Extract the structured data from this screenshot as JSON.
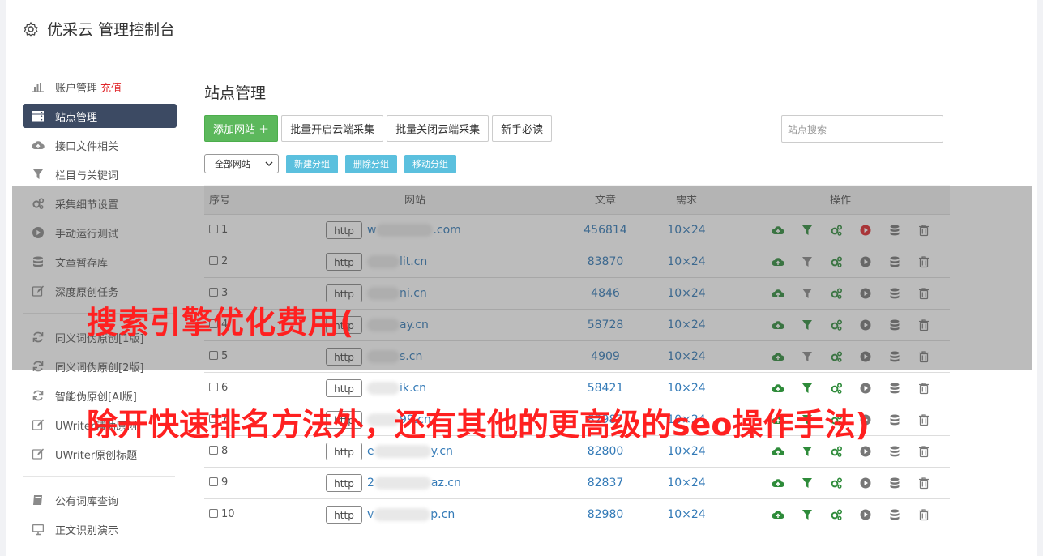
{
  "header": {
    "title": "优采云 管理控制台"
  },
  "sidebar": {
    "items": [
      {
        "label": "账户管理",
        "extra": "充值",
        "icon": "bar-chart-icon"
      },
      {
        "label": "站点管理",
        "icon": "server-icon",
        "active": true
      },
      {
        "label": "接口文件相关",
        "icon": "cloud-upload-icon"
      },
      {
        "label": "栏目与关键词",
        "icon": "filter-icon"
      },
      {
        "label": "采集细节设置",
        "icon": "gears-icon"
      },
      {
        "label": "手动运行测试",
        "icon": "play-circle-icon"
      },
      {
        "label": "文章暂存库",
        "icon": "database-icon"
      },
      {
        "label": "深度原创任务",
        "icon": "edit-icon"
      }
    ],
    "items2": [
      {
        "label": "同义词伪原创[1版]",
        "icon": "refresh-icon"
      },
      {
        "label": "同义词伪原创[2版]",
        "icon": "refresh-icon"
      },
      {
        "label": "智能伪原创[AI版]",
        "icon": "refresh-icon"
      },
      {
        "label": "UWriter辅助原创",
        "icon": "edit-icon"
      },
      {
        "label": "UWriter原创标题",
        "icon": "edit-icon"
      }
    ],
    "items3": [
      {
        "label": "公有词库查询",
        "icon": "book-icon"
      },
      {
        "label": "正文识别演示",
        "icon": "monitor-icon"
      }
    ]
  },
  "main": {
    "title": "站点管理",
    "buttons": {
      "add": "添加网站 ＋",
      "enable": "批量开启云端采集",
      "disable": "批量关闭云端采集",
      "guide": "新手必读"
    },
    "search_placeholder": "站点搜索",
    "group_select": "全部网站",
    "group_buttons": {
      "new": "新建分组",
      "delete": "删除分组",
      "move": "移动分组"
    },
    "columns": {
      "num": "序号",
      "site": "网站",
      "articles": "文章",
      "demand": "需求",
      "ops": "操作"
    },
    "rows": [
      {
        "num": "1",
        "prefix": "w",
        "suffix": ".com",
        "articles": "456814",
        "demand": "10×24",
        "play_active": true,
        "filter_active": true
      },
      {
        "num": "2",
        "prefix": "",
        "suffix": "lit.cn",
        "articles": "83870",
        "demand": "10×24",
        "play_active": false,
        "filter_active": false
      },
      {
        "num": "3",
        "prefix": "",
        "suffix": "ni.cn",
        "articles": "4846",
        "demand": "10×24",
        "play_active": false,
        "filter_active": false
      },
      {
        "num": "4",
        "prefix": "",
        "suffix": "ay.cn",
        "articles": "58728",
        "demand": "10×24",
        "play_active": false,
        "filter_active": true
      },
      {
        "num": "5",
        "prefix": "",
        "suffix": "s.cn",
        "articles": "4909",
        "demand": "10×24",
        "play_active": false,
        "filter_active": false
      },
      {
        "num": "6",
        "prefix": "",
        "suffix": "ik.cn",
        "articles": "58421",
        "demand": "10×24",
        "play_active": false,
        "filter_active": true
      },
      {
        "num": "7",
        "prefix": "",
        "suffix": "99.cn",
        "articles": "82987",
        "demand": "10×24",
        "play_active": false,
        "filter_active": true
      },
      {
        "num": "8",
        "prefix": "e",
        "suffix": "y.cn",
        "articles": "82800",
        "demand": "10×24",
        "play_active": false,
        "filter_active": true
      },
      {
        "num": "9",
        "prefix": "2",
        "suffix": "az.cn",
        "articles": "82837",
        "demand": "10×24",
        "play_active": false,
        "filter_active": true
      },
      {
        "num": "10",
        "prefix": "v",
        "suffix": "p.cn",
        "articles": "82980",
        "demand": "10×24",
        "play_active": false,
        "filter_active": true
      }
    ],
    "http_label": "http"
  },
  "overlay": {
    "line1": "搜索引擎优化费用(",
    "line2": "除开快速排名方法外，还有其他的更高级的seo操作手法)"
  },
  "colors": {
    "green": "#5cb85c",
    "active_nav": "#3c4a63",
    "link": "#337ab7",
    "accent_red": "#e0262a",
    "info": "#5bc0de"
  }
}
